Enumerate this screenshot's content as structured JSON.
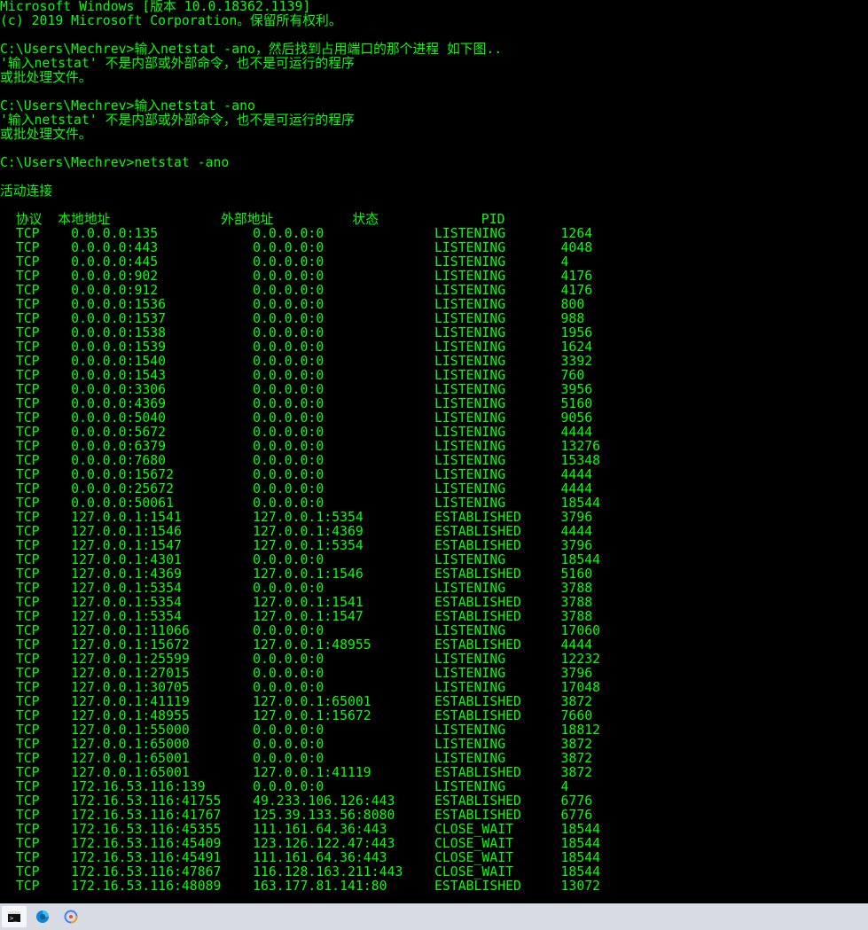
{
  "header": {
    "line1": "Microsoft Windows [版本 10.0.18362.1139]",
    "line2": "(c) 2019 Microsoft Corporation。保留所有权利。"
  },
  "block1": {
    "prompt": "C:\\Users\\Mechrev>",
    "cmd": "输入netstat -ano，然后找到占用端口的那个进程 如下图..",
    "err1": "'输入netstat' 不是内部或外部命令，也不是可运行的程序",
    "err2": "或批处理文件。"
  },
  "block2": {
    "prompt": "C:\\Users\\Mechrev>",
    "cmd": "输入netstat -ano",
    "err1": "'输入netstat' 不是内部或外部命令，也不是可运行的程序",
    "err2": "或批处理文件。"
  },
  "block3": {
    "prompt": "C:\\Users\\Mechrev>",
    "cmd": "netstat -ano"
  },
  "activeConn": "活动连接",
  "headers": {
    "proto": "协议",
    "local": "本地地址",
    "foreign": "外部地址",
    "state": "状态",
    "pid": "PID"
  },
  "rows": [
    {
      "proto": "TCP",
      "local": "0.0.0.0:135",
      "foreign": "0.0.0.0:0",
      "state": "LISTENING",
      "pid": "1264"
    },
    {
      "proto": "TCP",
      "local": "0.0.0.0:443",
      "foreign": "0.0.0.0:0",
      "state": "LISTENING",
      "pid": "4048"
    },
    {
      "proto": "TCP",
      "local": "0.0.0.0:445",
      "foreign": "0.0.0.0:0",
      "state": "LISTENING",
      "pid": "4"
    },
    {
      "proto": "TCP",
      "local": "0.0.0.0:902",
      "foreign": "0.0.0.0:0",
      "state": "LISTENING",
      "pid": "4176"
    },
    {
      "proto": "TCP",
      "local": "0.0.0.0:912",
      "foreign": "0.0.0.0:0",
      "state": "LISTENING",
      "pid": "4176"
    },
    {
      "proto": "TCP",
      "local": "0.0.0.0:1536",
      "foreign": "0.0.0.0:0",
      "state": "LISTENING",
      "pid": "800"
    },
    {
      "proto": "TCP",
      "local": "0.0.0.0:1537",
      "foreign": "0.0.0.0:0",
      "state": "LISTENING",
      "pid": "988"
    },
    {
      "proto": "TCP",
      "local": "0.0.0.0:1538",
      "foreign": "0.0.0.0:0",
      "state": "LISTENING",
      "pid": "1956"
    },
    {
      "proto": "TCP",
      "local": "0.0.0.0:1539",
      "foreign": "0.0.0.0:0",
      "state": "LISTENING",
      "pid": "1624"
    },
    {
      "proto": "TCP",
      "local": "0.0.0.0:1540",
      "foreign": "0.0.0.0:0",
      "state": "LISTENING",
      "pid": "3392"
    },
    {
      "proto": "TCP",
      "local": "0.0.0.0:1543",
      "foreign": "0.0.0.0:0",
      "state": "LISTENING",
      "pid": "760"
    },
    {
      "proto": "TCP",
      "local": "0.0.0.0:3306",
      "foreign": "0.0.0.0:0",
      "state": "LISTENING",
      "pid": "3956"
    },
    {
      "proto": "TCP",
      "local": "0.0.0.0:4369",
      "foreign": "0.0.0.0:0",
      "state": "LISTENING",
      "pid": "5160"
    },
    {
      "proto": "TCP",
      "local": "0.0.0.0:5040",
      "foreign": "0.0.0.0:0",
      "state": "LISTENING",
      "pid": "9056"
    },
    {
      "proto": "TCP",
      "local": "0.0.0.0:5672",
      "foreign": "0.0.0.0:0",
      "state": "LISTENING",
      "pid": "4444"
    },
    {
      "proto": "TCP",
      "local": "0.0.0.0:6379",
      "foreign": "0.0.0.0:0",
      "state": "LISTENING",
      "pid": "13276"
    },
    {
      "proto": "TCP",
      "local": "0.0.0.0:7680",
      "foreign": "0.0.0.0:0",
      "state": "LISTENING",
      "pid": "15348"
    },
    {
      "proto": "TCP",
      "local": "0.0.0.0:15672",
      "foreign": "0.0.0.0:0",
      "state": "LISTENING",
      "pid": "4444"
    },
    {
      "proto": "TCP",
      "local": "0.0.0.0:25672",
      "foreign": "0.0.0.0:0",
      "state": "LISTENING",
      "pid": "4444"
    },
    {
      "proto": "TCP",
      "local": "0.0.0.0:50061",
      "foreign": "0.0.0.0:0",
      "state": "LISTENING",
      "pid": "18544"
    },
    {
      "proto": "TCP",
      "local": "127.0.0.1:1541",
      "foreign": "127.0.0.1:5354",
      "state": "ESTABLISHED",
      "pid": "3796"
    },
    {
      "proto": "TCP",
      "local": "127.0.0.1:1546",
      "foreign": "127.0.0.1:4369",
      "state": "ESTABLISHED",
      "pid": "4444"
    },
    {
      "proto": "TCP",
      "local": "127.0.0.1:1547",
      "foreign": "127.0.0.1:5354",
      "state": "ESTABLISHED",
      "pid": "3796"
    },
    {
      "proto": "TCP",
      "local": "127.0.0.1:4301",
      "foreign": "0.0.0.0:0",
      "state": "LISTENING",
      "pid": "18544"
    },
    {
      "proto": "TCP",
      "local": "127.0.0.1:4369",
      "foreign": "127.0.0.1:1546",
      "state": "ESTABLISHED",
      "pid": "5160"
    },
    {
      "proto": "TCP",
      "local": "127.0.0.1:5354",
      "foreign": "0.0.0.0:0",
      "state": "LISTENING",
      "pid": "3788"
    },
    {
      "proto": "TCP",
      "local": "127.0.0.1:5354",
      "foreign": "127.0.0.1:1541",
      "state": "ESTABLISHED",
      "pid": "3788"
    },
    {
      "proto": "TCP",
      "local": "127.0.0.1:5354",
      "foreign": "127.0.0.1:1547",
      "state": "ESTABLISHED",
      "pid": "3788"
    },
    {
      "proto": "TCP",
      "local": "127.0.0.1:11066",
      "foreign": "0.0.0.0:0",
      "state": "LISTENING",
      "pid": "17060"
    },
    {
      "proto": "TCP",
      "local": "127.0.0.1:15672",
      "foreign": "127.0.0.1:48955",
      "state": "ESTABLISHED",
      "pid": "4444"
    },
    {
      "proto": "TCP",
      "local": "127.0.0.1:25599",
      "foreign": "0.0.0.0:0",
      "state": "LISTENING",
      "pid": "12232"
    },
    {
      "proto": "TCP",
      "local": "127.0.0.1:27015",
      "foreign": "0.0.0.0:0",
      "state": "LISTENING",
      "pid": "3796"
    },
    {
      "proto": "TCP",
      "local": "127.0.0.1:30705",
      "foreign": "0.0.0.0:0",
      "state": "LISTENING",
      "pid": "17048"
    },
    {
      "proto": "TCP",
      "local": "127.0.0.1:41119",
      "foreign": "127.0.0.1:65001",
      "state": "ESTABLISHED",
      "pid": "3872"
    },
    {
      "proto": "TCP",
      "local": "127.0.0.1:48955",
      "foreign": "127.0.0.1:15672",
      "state": "ESTABLISHED",
      "pid": "7660"
    },
    {
      "proto": "TCP",
      "local": "127.0.0.1:55000",
      "foreign": "0.0.0.0:0",
      "state": "LISTENING",
      "pid": "18812"
    },
    {
      "proto": "TCP",
      "local": "127.0.0.1:65000",
      "foreign": "0.0.0.0:0",
      "state": "LISTENING",
      "pid": "3872"
    },
    {
      "proto": "TCP",
      "local": "127.0.0.1:65001",
      "foreign": "0.0.0.0:0",
      "state": "LISTENING",
      "pid": "3872"
    },
    {
      "proto": "TCP",
      "local": "127.0.0.1:65001",
      "foreign": "127.0.0.1:41119",
      "state": "ESTABLISHED",
      "pid": "3872"
    },
    {
      "proto": "TCP",
      "local": "172.16.53.116:139",
      "foreign": "0.0.0.0:0",
      "state": "LISTENING",
      "pid": "4"
    },
    {
      "proto": "TCP",
      "local": "172.16.53.116:41755",
      "foreign": "49.233.106.126:443",
      "state": "ESTABLISHED",
      "pid": "6776"
    },
    {
      "proto": "TCP",
      "local": "172.16.53.116:41767",
      "foreign": "125.39.133.56:8080",
      "state": "ESTABLISHED",
      "pid": "6776"
    },
    {
      "proto": "TCP",
      "local": "172.16.53.116:45355",
      "foreign": "111.161.64.36:443",
      "state": "CLOSE_WAIT",
      "pid": "18544"
    },
    {
      "proto": "TCP",
      "local": "172.16.53.116:45409",
      "foreign": "123.126.122.47:443",
      "state": "CLOSE_WAIT",
      "pid": "18544"
    },
    {
      "proto": "TCP",
      "local": "172.16.53.116:45491",
      "foreign": "111.161.64.36:443",
      "state": "CLOSE_WAIT",
      "pid": "18544"
    },
    {
      "proto": "TCP",
      "local": "172.16.53.116:47867",
      "foreign": "116.128.163.211:443",
      "state": "CLOSE_WAIT",
      "pid": "18544"
    },
    {
      "proto": "TCP",
      "local": "172.16.53.116:48089",
      "foreign": "163.177.81.141:80",
      "state": "ESTABLISHED",
      "pid": "13072"
    }
  ]
}
